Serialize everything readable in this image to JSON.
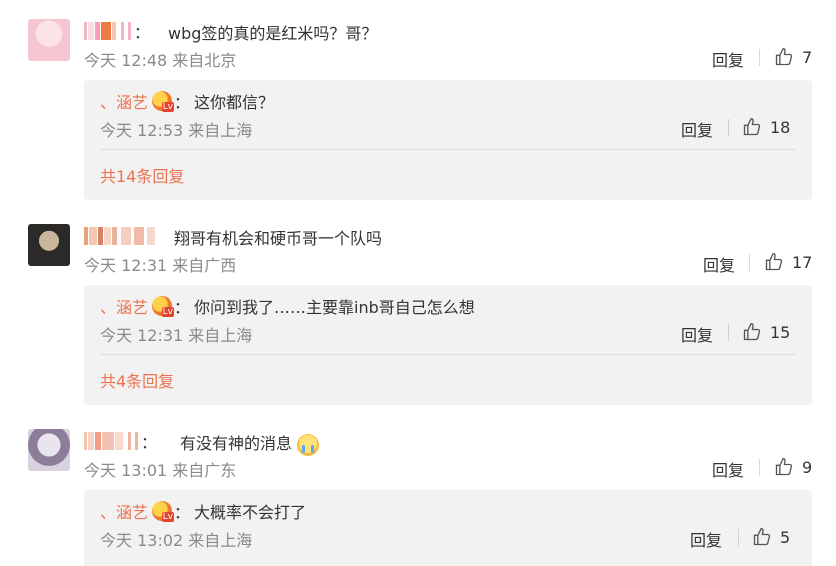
{
  "comments": [
    {
      "text": "wbg签的真的是红米吗？哥？",
      "meta": "今天 12:48 来自北京",
      "reply_label": "回复",
      "likes": "7",
      "reply": {
        "name": "、涵艺",
        "text": "这你都信？",
        "meta": "今天 12:53 来自上海",
        "reply_label": "回复",
        "likes": "18",
        "more": "共14条回复"
      }
    },
    {
      "text": "翔哥有机会和硬币哥一个队吗",
      "meta": "今天 12:31 来自广西",
      "reply_label": "回复",
      "likes": "17",
      "reply": {
        "name": "、涵艺",
        "text": "你问到我了……主要靠inb哥自己怎么想",
        "meta": "今天 12:31 来自上海",
        "reply_label": "回复",
        "likes": "15",
        "more": "共4条回复"
      }
    },
    {
      "text": "有没有神的消息",
      "meta": "今天 13:01 来自广东",
      "reply_label": "回复",
      "likes": "9",
      "reply": {
        "name": "、涵艺",
        "text": "大概率不会打了",
        "meta": "今天 13:02 来自上海",
        "reply_label": "回复",
        "likes": "5"
      }
    }
  ],
  "punct": {
    "colon": "："
  },
  "colors": {
    "accent": "#eb7350",
    "meta": "#8a8a8a",
    "reply_bg": "#f2f2f2"
  },
  "icons": {
    "like": "thumbs-up-icon",
    "badge": "member-badge-icon",
    "emoji": "crying-face-icon"
  }
}
